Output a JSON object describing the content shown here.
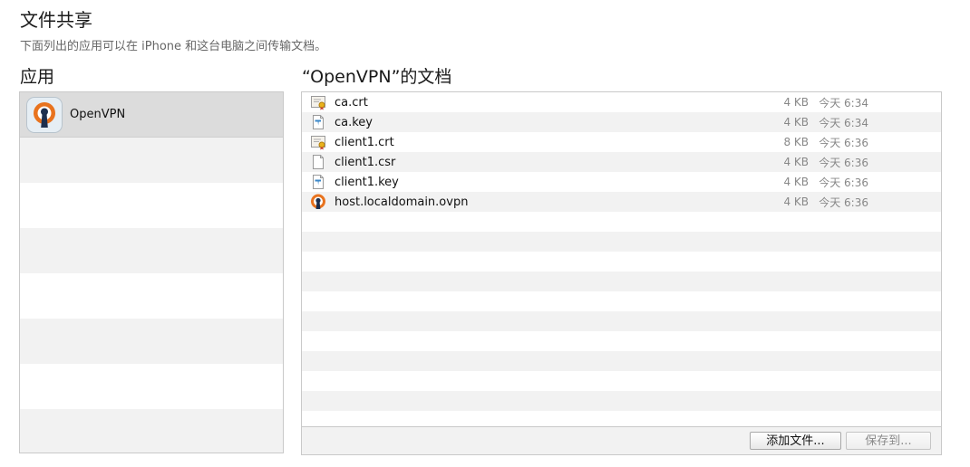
{
  "header": {
    "title": "文件共享",
    "subtitle": "下面列出的应用可以在 iPhone 和这台电脑之间传输文档。"
  },
  "apps": {
    "heading": "应用",
    "items": [
      {
        "name": "OpenVPN",
        "icon": "openvpn-app-icon",
        "selected": true
      }
    ]
  },
  "documents": {
    "heading": "“OpenVPN”的文档",
    "files": [
      {
        "name": "ca.crt",
        "size": "4 KB",
        "date": "今天 6:34",
        "icon": "certificate-file-icon"
      },
      {
        "name": "ca.key",
        "size": "4 KB",
        "date": "今天 6:34",
        "icon": "key-file-icon"
      },
      {
        "name": "client1.crt",
        "size": "8 KB",
        "date": "今天 6:36",
        "icon": "certificate-file-icon"
      },
      {
        "name": "client1.csr",
        "size": "4 KB",
        "date": "今天 6:36",
        "icon": "generic-file-icon"
      },
      {
        "name": "client1.key",
        "size": "4 KB",
        "date": "今天 6:36",
        "icon": "key-file-icon"
      },
      {
        "name": "host.localdomain.ovpn",
        "size": "4 KB",
        "date": "今天 6:36",
        "icon": "openvpn-file-icon"
      }
    ],
    "add_button": "添加文件...",
    "save_button": "保存到..."
  },
  "colors": {
    "openvpn_orange": "#e8731f",
    "openvpn_navy": "#1d2f4e",
    "selected_row": "#dcdcdc",
    "stripe": "#f2f2f2"
  }
}
